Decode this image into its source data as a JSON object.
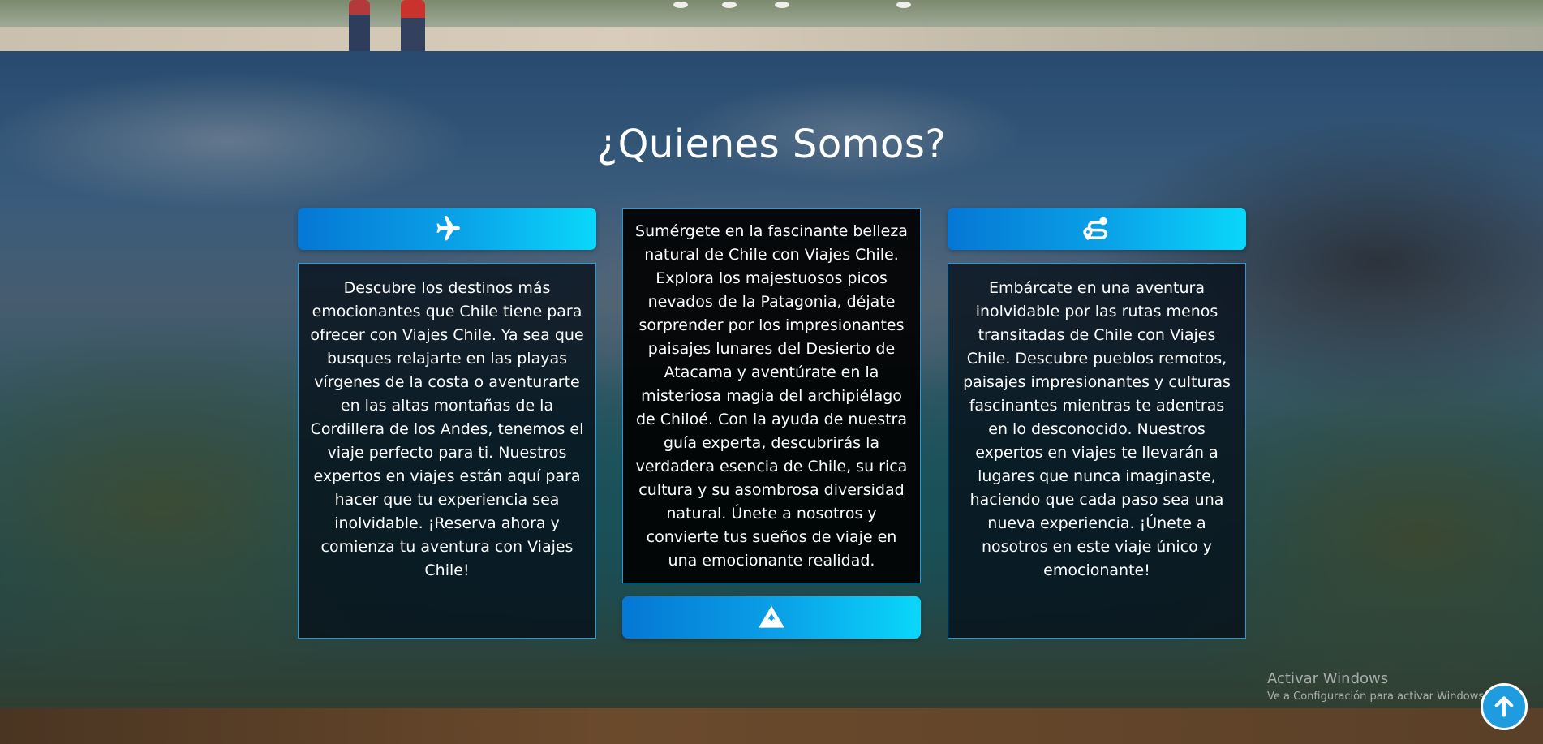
{
  "about": {
    "title": "¿Quienes Somos?",
    "cards": [
      {
        "icon": "plane-icon",
        "text": "Descubre los destinos más emocionantes que Chile tiene para ofrecer con Viajes Chile. Ya sea que busques relajarte en las playas vírgenes de la costa o aventurarte en las altas montañas de la Cordillera de los Andes, tenemos el viaje perfecto para ti. Nuestros expertos en viajes están aquí para hacer que tu experiencia sea inolvidable. ¡Reserva ahora y comienza tu aventura con Viajes Chile!"
      },
      {
        "icon": "mountain-icon",
        "text": "Sumérgete en la fascinante belleza natural de Chile con Viajes Chile. Explora los majestuosos picos nevados de la Patagonia, déjate sorprender por los impresionantes paisajes lunares del Desierto de Atacama y aventúrate en la misteriosa magia del archipiélago de Chiloé. Con la ayuda de nuestra guía experta, descubrirás la verdadera esencia de Chile, su rica cultura y su asombrosa diversidad natural. Únete a nosotros y convierte tus sueños de viaje en una emocionante realidad."
      },
      {
        "icon": "route-icon",
        "text": "Embárcate en una aventura inolvidable por las rutas menos transitadas de Chile con Viajes Chile. Descubre pueblos remotos, paisajes impresionantes y culturas fascinantes mientras te adentras en lo desconocido. Nuestros expertos en viajes te llevarán a lugares que nunca imaginaste, haciendo que cada paso sea una nueva experiencia. ¡Únete a nosotros en este viaje único y emocionante!"
      }
    ]
  },
  "watermark": {
    "title": "Activar Windows",
    "subtitle": "Ve a Configuración para activar Windows."
  },
  "scroll_top": {
    "icon": "arrow-up-icon"
  },
  "colors": {
    "accent_start": "#0577d4",
    "accent_end": "#0ad7fb",
    "card_border": "#1f9be0"
  }
}
